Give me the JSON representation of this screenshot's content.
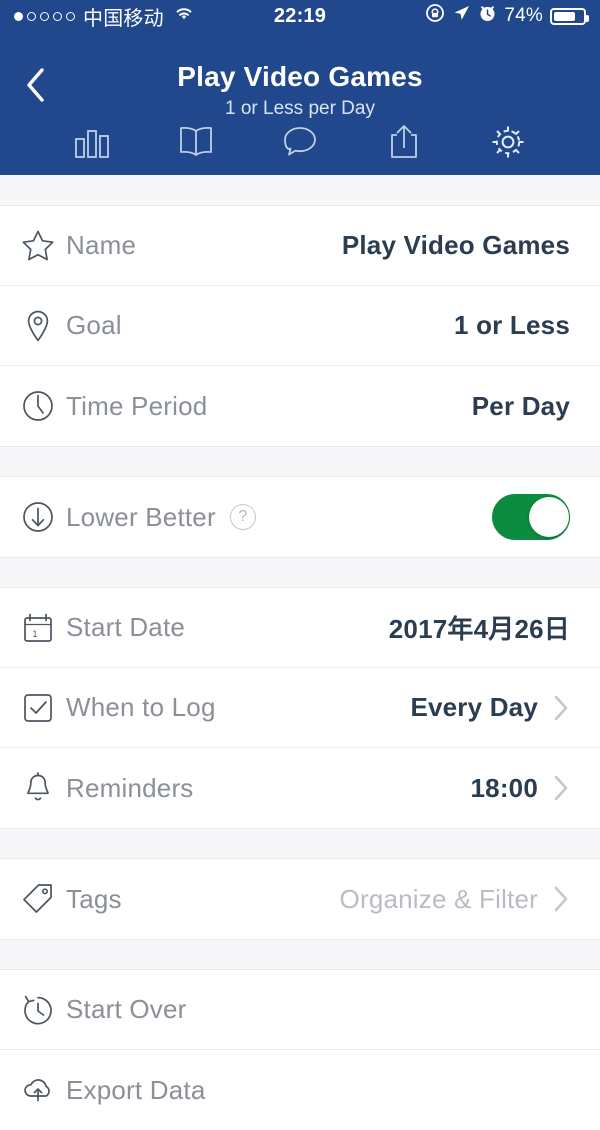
{
  "status_bar": {
    "signal_dots_total": 5,
    "signal_dots_filled": 1,
    "carrier": "中国移动",
    "wifi_icon": "wifi-icon",
    "time": "22:19",
    "rotation_lock_icon": "rotation-lock-icon",
    "location_icon": "location-arrow-icon",
    "alarm_icon": "alarm-clock-icon",
    "battery_percent": "74%",
    "battery_icon": "battery-icon"
  },
  "header": {
    "back_icon": "chevron-left-icon",
    "title": "Play Video Games",
    "subtitle": "1 or Less per Day",
    "tabs": [
      {
        "name": "tab-chart",
        "icon": "bar-chart-icon"
      },
      {
        "name": "tab-journal",
        "icon": "open-book-icon"
      },
      {
        "name": "tab-notes",
        "icon": "speech-bubble-icon"
      },
      {
        "name": "tab-share",
        "icon": "share-upload-icon"
      },
      {
        "name": "tab-settings",
        "icon": "gear-icon"
      }
    ]
  },
  "settings": {
    "group_1": [
      {
        "icon": "star-icon",
        "label": "Name",
        "value": "Play Video Games",
        "muted": false,
        "chevron": false
      },
      {
        "icon": "map-pin-icon",
        "label": "Goal",
        "value": "1 or Less",
        "muted": false,
        "chevron": false
      },
      {
        "icon": "clock-icon",
        "label": "Time Period",
        "value": "Per Day",
        "muted": false,
        "chevron": false
      }
    ],
    "group_2": [
      {
        "icon": "arrow-down-circle-icon",
        "label": "Lower Better",
        "help": "?",
        "toggle": true,
        "toggle_on": true
      }
    ],
    "group_3": [
      {
        "icon": "calendar-icon",
        "label": "Start Date",
        "value": "2017年4月26日",
        "muted": false,
        "chevron": false
      },
      {
        "icon": "checkbox-icon",
        "label": "When to Log",
        "value": "Every Day",
        "muted": false,
        "chevron": true
      },
      {
        "icon": "bell-icon",
        "label": "Reminders",
        "value": "18:00",
        "muted": false,
        "chevron": true
      }
    ],
    "group_4": [
      {
        "icon": "tag-icon",
        "label": "Tags",
        "value": "Organize & Filter",
        "muted": true,
        "chevron": true
      }
    ],
    "group_5": [
      {
        "icon": "history-clock-icon",
        "label": "Start Over",
        "value": "",
        "muted": false,
        "chevron": false
      },
      {
        "icon": "cloud-upload-icon",
        "label": "Export Data",
        "value": "",
        "muted": false,
        "chevron": false
      }
    ]
  },
  "colors": {
    "header_blue": "#21488c",
    "toggle_green": "#0c8c3f",
    "value_navy": "#2b3d51",
    "label_gray": "#8b8f98",
    "muted_gray": "#b8bcc4"
  }
}
